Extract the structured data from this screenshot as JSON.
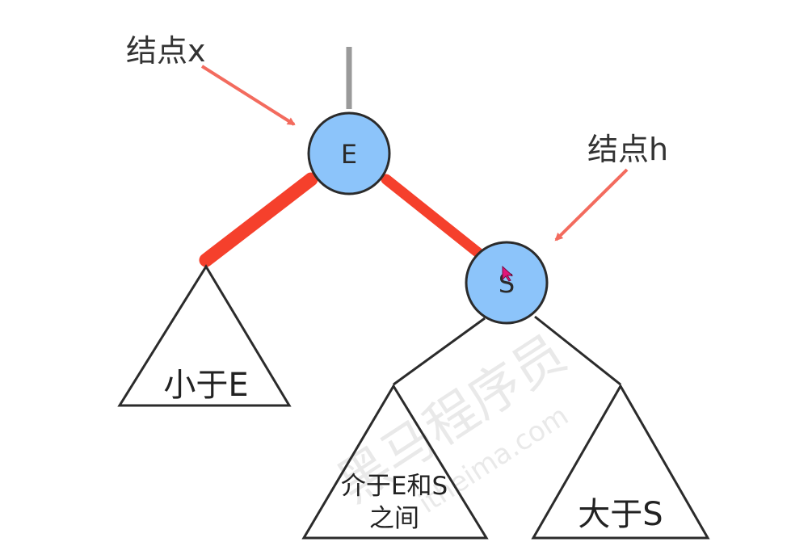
{
  "nodes": {
    "e": {
      "label": "E",
      "fill": "#8cc4fa"
    },
    "s": {
      "label": "S",
      "fill": "#8cc4fa"
    }
  },
  "callouts": {
    "node_x": "结点x",
    "node_h": "结点h"
  },
  "subtrees": {
    "less_than_e": "小于E",
    "between_line1": "介于E和S",
    "between_line2": "之间",
    "greater_than_s": "大于S"
  },
  "watermark": {
    "brand": "黑马程序员",
    "site": "itheima.com"
  },
  "colors": {
    "red_link": "#f5402c",
    "arrow": "#f36b5e",
    "parent_link": "#9a9a9a",
    "outline": "#2b2b2b"
  },
  "icons": {
    "cursor": "pointer-cursor-icon"
  }
}
